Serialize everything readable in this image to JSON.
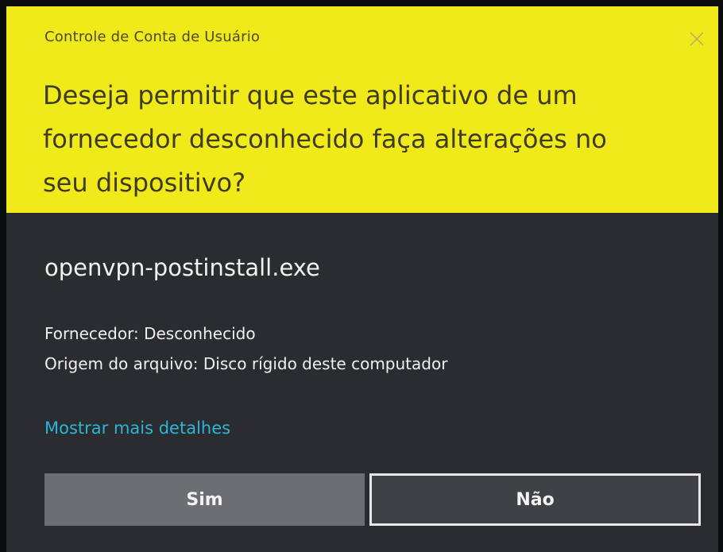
{
  "dialog": {
    "title": "Controle de Conta de Usuário",
    "close_icon": "close-icon",
    "question_lines": [
      "Deseja permitir que este aplicativo de um",
      "fornecedor desconhecido faça alterações no",
      "seu dispositivo?"
    ],
    "program_name": "openvpn-postinstall.exe",
    "publisher": "Fornecedor: Desconhecido",
    "origin": "Origem do arquivo: Disco rígido deste computador",
    "details_link": "Mostrar mais detalhes",
    "buttons": {
      "yes": "Sim",
      "no": "Não"
    }
  },
  "colors": {
    "header_background": "#f1ea1b",
    "body_background": "#2a2c30",
    "link": "#2bb5d8",
    "yes_button": "#6d6e71",
    "no_button": "#3f4145"
  }
}
